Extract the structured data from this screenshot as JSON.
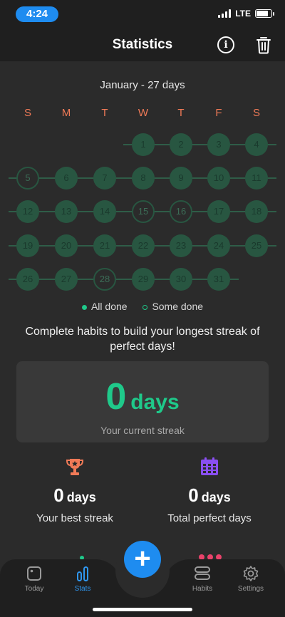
{
  "status_bar": {
    "time": "4:24",
    "network": "LTE"
  },
  "header": {
    "title": "Statistics",
    "info_icon": "info-icon",
    "trash_icon": "trash-icon"
  },
  "calendar": {
    "month_label": "January - 27 days",
    "weekdays": [
      "S",
      "M",
      "T",
      "W",
      "T",
      "F",
      "S"
    ],
    "weeks": [
      [
        null,
        null,
        null,
        {
          "day": "1",
          "state": "filled"
        },
        {
          "day": "2",
          "state": "filled"
        },
        {
          "day": "3",
          "state": "filled"
        },
        {
          "day": "4",
          "state": "filled"
        }
      ],
      [
        {
          "day": "5",
          "state": "outline"
        },
        {
          "day": "6",
          "state": "filled"
        },
        {
          "day": "7",
          "state": "filled"
        },
        {
          "day": "8",
          "state": "filled"
        },
        {
          "day": "9",
          "state": "filled"
        },
        {
          "day": "10",
          "state": "filled"
        },
        {
          "day": "11",
          "state": "filled"
        }
      ],
      [
        {
          "day": "12",
          "state": "filled"
        },
        {
          "day": "13",
          "state": "filled"
        },
        {
          "day": "14",
          "state": "filled"
        },
        {
          "day": "15",
          "state": "outline"
        },
        {
          "day": "16",
          "state": "outline"
        },
        {
          "day": "17",
          "state": "filled"
        },
        {
          "day": "18",
          "state": "filled"
        }
      ],
      [
        {
          "day": "19",
          "state": "filled"
        },
        {
          "day": "20",
          "state": "filled"
        },
        {
          "day": "21",
          "state": "filled"
        },
        {
          "day": "22",
          "state": "filled"
        },
        {
          "day": "23",
          "state": "filled"
        },
        {
          "day": "24",
          "state": "filled"
        },
        {
          "day": "25",
          "state": "filled"
        }
      ],
      [
        {
          "day": "26",
          "state": "filled"
        },
        {
          "day": "27",
          "state": "filled"
        },
        {
          "day": "28",
          "state": "outline"
        },
        {
          "day": "29",
          "state": "filled"
        },
        {
          "day": "30",
          "state": "filled"
        },
        {
          "day": "31",
          "state": "filled"
        },
        null
      ]
    ],
    "legend": {
      "all_done": "All done",
      "some_done": "Some done"
    }
  },
  "message": "Complete habits to build your longest streak of perfect days!",
  "current_streak": {
    "value": "0",
    "unit": "days",
    "label": "Your current streak"
  },
  "best_streak": {
    "value": "0",
    "unit": "days",
    "label": "Your best streak",
    "icon": "trophy-icon"
  },
  "perfect_days": {
    "value": "0",
    "unit": "days",
    "label": "Total perfect days",
    "icon": "calendar-icon"
  },
  "nav": {
    "tabs": [
      {
        "label": "Today",
        "icon": "dice-icon",
        "active": false
      },
      {
        "label": "Stats",
        "icon": "bar-chart-icon",
        "active": true
      },
      {
        "label": "Habits",
        "icon": "stack-icon",
        "active": false
      },
      {
        "label": "Settings",
        "icon": "gear-icon",
        "active": false
      }
    ],
    "add_label": "+"
  },
  "colors": {
    "accent": "#1e8cf0",
    "streak": "#1fc98a",
    "weekday": "#f07a57",
    "done_day": "#285641",
    "trophy": "#f07a57",
    "calendar": "#8a4ff0"
  }
}
